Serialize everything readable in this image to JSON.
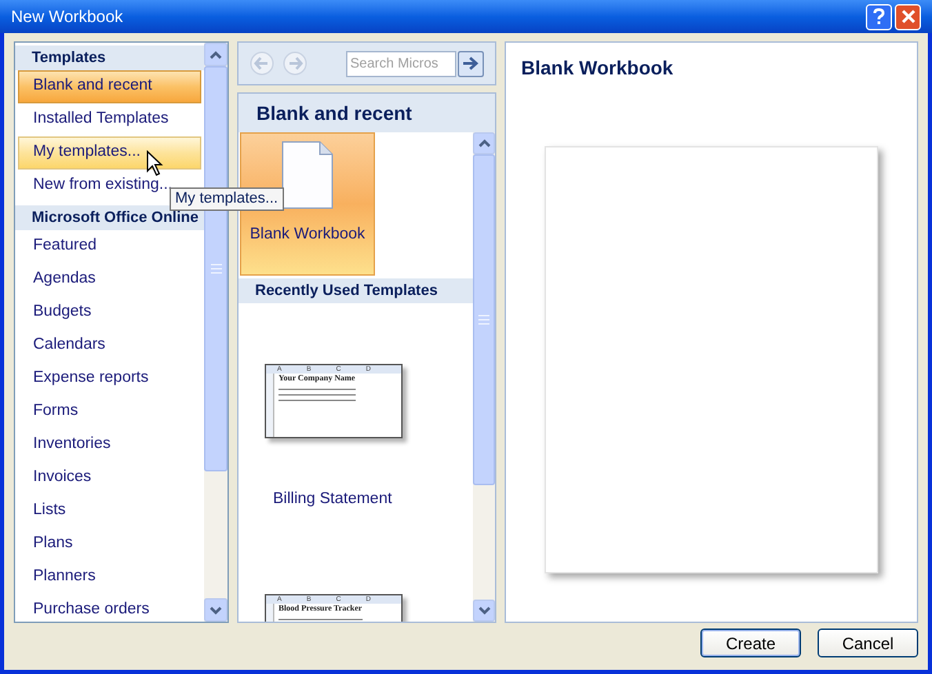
{
  "window": {
    "title": "New Workbook"
  },
  "sidebar": {
    "items": [
      {
        "kind": "header",
        "label": "Templates"
      },
      {
        "kind": "item",
        "label": "Blank and recent",
        "selected": true,
        "hovered": false
      },
      {
        "kind": "item",
        "label": "Installed Templates",
        "selected": false,
        "hovered": false
      },
      {
        "kind": "item",
        "label": "My templates...",
        "selected": false,
        "hovered": true
      },
      {
        "kind": "item",
        "label": "New from existing...",
        "selected": false,
        "hovered": false
      },
      {
        "kind": "header",
        "label": "Microsoft Office Online"
      },
      {
        "kind": "item",
        "label": "Featured",
        "selected": false,
        "hovered": false
      },
      {
        "kind": "item",
        "label": "Agendas",
        "selected": false,
        "hovered": false
      },
      {
        "kind": "item",
        "label": "Budgets",
        "selected": false,
        "hovered": false
      },
      {
        "kind": "item",
        "label": "Calendars",
        "selected": false,
        "hovered": false
      },
      {
        "kind": "item",
        "label": "Expense reports",
        "selected": false,
        "hovered": false
      },
      {
        "kind": "item",
        "label": "Forms",
        "selected": false,
        "hovered": false
      },
      {
        "kind": "item",
        "label": "Inventories",
        "selected": false,
        "hovered": false
      },
      {
        "kind": "item",
        "label": "Invoices",
        "selected": false,
        "hovered": false
      },
      {
        "kind": "item",
        "label": "Lists",
        "selected": false,
        "hovered": false
      },
      {
        "kind": "item",
        "label": "Plans",
        "selected": false,
        "hovered": false
      },
      {
        "kind": "item",
        "label": "Planners",
        "selected": false,
        "hovered": false
      },
      {
        "kind": "item",
        "label": "Purchase orders",
        "selected": false,
        "hovered": false
      }
    ]
  },
  "tooltip": "My templates...",
  "search": {
    "placeholder": "Search Micros"
  },
  "middle": {
    "title": "Blank and recent",
    "blank_tile": {
      "label": "Blank Workbook",
      "selected": true
    },
    "recent_header": "Recently Used Templates",
    "recent": [
      {
        "columns": [
          "A",
          "B",
          "C",
          "D"
        ],
        "thumb_title": "Your Company Name",
        "label": "Billing Statement"
      },
      {
        "columns": [
          "A",
          "B",
          "C",
          "D"
        ],
        "thumb_title": "Blood Pressure Tracker"
      }
    ]
  },
  "preview": {
    "title": "Blank Workbook"
  },
  "buttons": [
    "Create",
    "Cancel"
  ]
}
